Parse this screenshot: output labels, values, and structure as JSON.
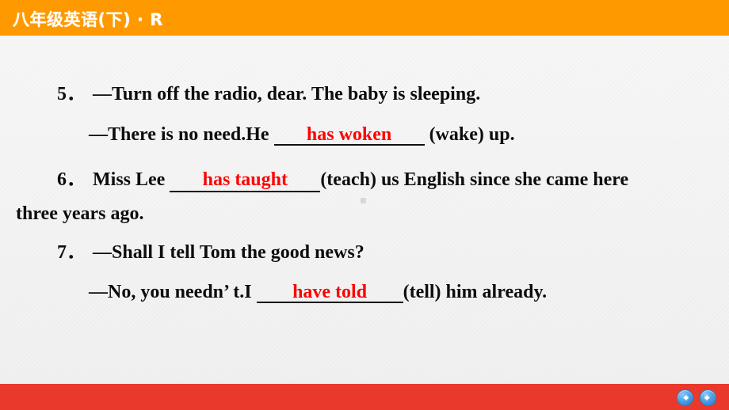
{
  "header": {
    "title": "八年级英语(下) · R",
    "background_color": "#FF9900",
    "text_color": "#FFFFFF"
  },
  "footer": {
    "background_color": "#E8392C",
    "prev_button": {
      "icon": "arrow-left-icon",
      "label": ""
    },
    "next_button": {
      "icon": "arrow-right-icon",
      "label": ""
    }
  },
  "answer_color": "#FF0000",
  "exercises": [
    {
      "number": "5．",
      "lines": [
        {
          "text": "—Turn off the radio, dear. The baby is sleeping."
        },
        {
          "before": "—There is no need.He ",
          "answer": "has woken",
          "after": " (wake) up."
        }
      ]
    },
    {
      "number": "6．",
      "line_part1": "Miss  Lee ",
      "answer": "has taught",
      "line_part2": "(teach)  us  English  since  she  came  here",
      "line_part3": "three years ago."
    },
    {
      "number": "7．",
      "lines": [
        {
          "text": "—Shall I tell Tom the good news?"
        },
        {
          "before": "—No, you needn’ t.I ",
          "answer": "have told",
          "after": "(tell) him already."
        }
      ]
    }
  ]
}
